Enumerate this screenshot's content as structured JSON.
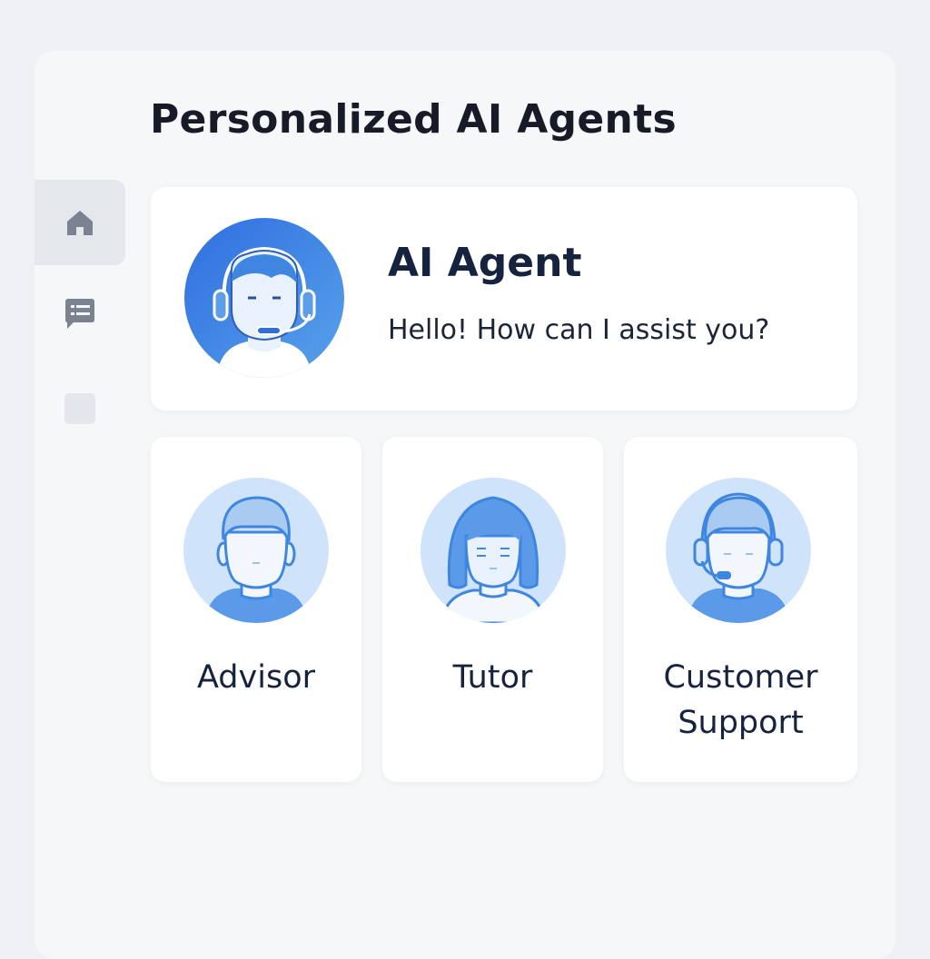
{
  "page": {
    "title": "Personalized AI Agents"
  },
  "sidebar": {
    "items": [
      {
        "name": "home",
        "icon": "home-icon",
        "active": true
      },
      {
        "name": "messages",
        "icon": "message-icon",
        "active": false
      },
      {
        "name": "other",
        "icon": "square-icon",
        "active": false
      }
    ]
  },
  "hero": {
    "name": "AI Agent",
    "message": "Hello! How can I assist you?",
    "avatar_icon": "headset-agent-avatar"
  },
  "agents": [
    {
      "label": "Advisor",
      "avatar_icon": "advisor-avatar"
    },
    {
      "label": "Tutor",
      "avatar_icon": "tutor-avatar"
    },
    {
      "label": "Customer Support",
      "avatar_icon": "support-avatar"
    }
  ],
  "colors": {
    "accent_blue": "#3f86e0",
    "light_blue": "#cfe3fa",
    "text_dark": "#16233f",
    "icon_gray": "#7b8390"
  }
}
